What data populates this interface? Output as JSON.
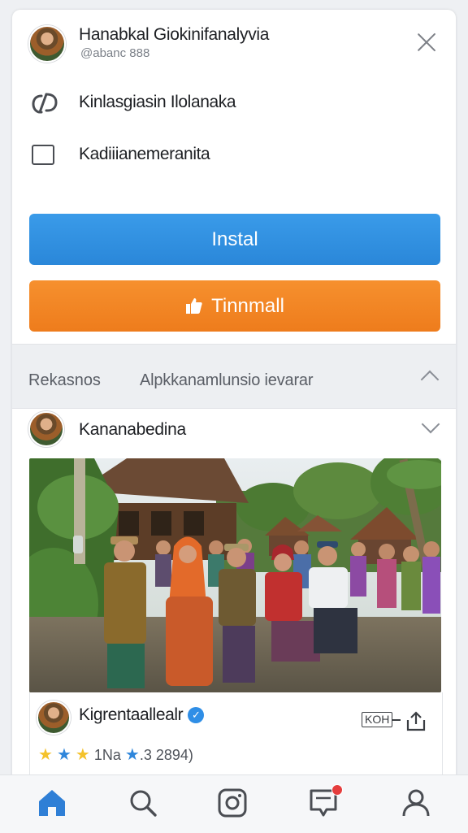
{
  "header": {
    "app_title": "Hanabkal Giokinifanalyvia",
    "app_handle": "@abanc 888"
  },
  "options": [
    {
      "label": "Kinlasgiasin Ilolanaka",
      "icon": "link-icon"
    },
    {
      "label": "Kadiiianemeranita",
      "icon": "checkbox-icon"
    }
  ],
  "buttons": {
    "install_label": "Instal",
    "download_label": "Tinnmall"
  },
  "section_bar": {
    "left_label": "Rekasnos",
    "right_label": "Alpkkanamlunsio ievarar"
  },
  "post": {
    "author": "Kananabedina",
    "image_description_icon": "group-photo"
  },
  "comment": {
    "name": "Kigrentaallealr",
    "stat_label": "KOH",
    "rating_text": "1Na",
    "rating_count": ".3 2894)"
  },
  "colors": {
    "install": "#2a87d9",
    "download": "#ee7c1c",
    "verified": "#2f8ee6",
    "nav_active": "#2f7fd6",
    "notification": "#e53d3d"
  },
  "nav": [
    "home-icon",
    "search-icon",
    "instagram-icon",
    "inbox-icon",
    "profile-icon"
  ]
}
